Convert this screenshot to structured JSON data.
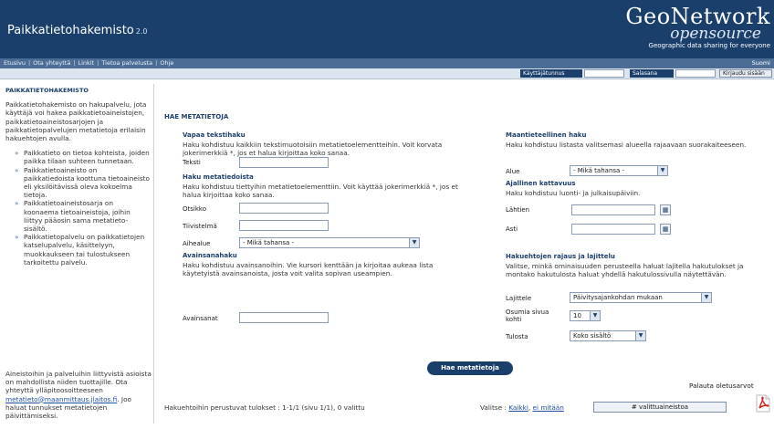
{
  "header": {
    "title": "Paikkatietohakemisto",
    "version": "2.0",
    "logo_main": "GeoNetwork",
    "logo_sub": "opensource",
    "logo_tagline": "Geographic data sharing for everyone"
  },
  "topnav": {
    "links": [
      "Etusivu",
      "Ota yhteyttä",
      "Linkit",
      "Tietoa palvelusta",
      "Ohje"
    ],
    "right": "Suomi"
  },
  "loginbar": {
    "user_label": "Käyttäjätunnus",
    "password_label": "Salasana",
    "login_button": "Kirjaudu sisään"
  },
  "sidebar": {
    "title": "PAIKKATIETOHAKEMISTO",
    "intro": "Paikkatietohakemisto on hakupalvelu, jota käyttäjä voi hakea paikkatietoaineistojen, paikkatietoaineistosarjojen ja paikkatietopalvelujen metatietoja erilaisin hakuehtojen avulla.",
    "items": [
      "Paikkatieto on tietoa kohteista, joiden paikka tilaan suhteen tunnetaan.",
      "Paikkatietoaineisto on paikkatiedoista koottuna tietoaineisto eli yksilöitävissä oleva kokoelma tietoja.",
      "Paikkatietoaineistosarja on koonaema tietoaineistoja, joihin liittyy pääosin sama metatieto-sisältö.",
      "Paikkatietopalvelu on paikkatietojen katselupalvelu, käsittelyyn, muokkaukseen tai tulostukseen tarkoitettu palvelu."
    ],
    "footer_text": "Aineistoihin ja palveluihin liittyvistä asioista on mahdollista niiden tuottajille. Ota yhteyttä ylläpitoosoitteeseen",
    "footer_email": "metatieto@maanmittaus.jlaitos.fi",
    "footer_text2": ". Joo haluat tunnukset metatietojen päivittämiseksi."
  },
  "main": {
    "heading": "HAE METATIETOJA",
    "free_text": {
      "title": "Vapaa tekstihaku",
      "desc": "Haku kohdistuu kaikkiin tekstimuotoisiin metatietoelementteihin. Voit korvata jokerimerkkiä *, jos et halua kirjoittaa koko sanaa.",
      "field_label": "Teksti"
    },
    "elements": {
      "title": "Haku metatiedoista",
      "desc": "Haku kohdistuu tiettyihin metatietoelementtiin. Voit käyttää jokerimerkkiä *, jos et halua kirjoittaa koko sanaa.",
      "title_label": "Otsikko",
      "abstract_label": "Tiivistelmä",
      "category_label": "Aihealue",
      "category_value": "- Mikä tahansa -"
    },
    "keyword": {
      "title": "Avainsanahaku",
      "desc": "Haku kohdistuu avainsanoihin. Vie kursori kenttään ja kirjoitaa aukeaa lista käytetyistä avainsanoista, josta voit valita sopivan useampien.",
      "field_label": "Avainsanat"
    },
    "spatial": {
      "title": "Maantieteellinen haku",
      "desc": "Haku kohdistuu listasta valitsemasi alueella rajaavaan suorakaiteeseen.",
      "area_label": "Alue",
      "area_value": "- Mikä tahansa -"
    },
    "temporal": {
      "title": "Ajallinen kattavuus",
      "desc": "Haku kohdistuu luonti- ja julkaisupäiviin.",
      "from_label": "Lähtien",
      "to_label": "Asti"
    },
    "options": {
      "title": "Hakuehtojen rajaus ja lajittelu",
      "desc": "Valitse, minkä ominaisuuden perusteella haluat lajitella hakutulokset ja montako hakutulosta haluat yhdellä hakutulossivulla näytettävän.",
      "sort_label": "Lajittele",
      "sort_value": "Päivitysajankohdan mukaan",
      "hits_label": "Osumia sivua kohti",
      "hits_value": "10",
      "output_label": "Tulosta",
      "output_value": "Koko sisältö"
    },
    "search_button": "Hae metatietoja",
    "reset_link": "Palauta oletusarvot",
    "results_text": "Hakuehtoihin perustuvat tulokset :  1-1/1  (sivu 1/1),  0 valittu",
    "choose_label": "Valitse :",
    "choose_all": "Kaikki",
    "choose_none": "ei mitään",
    "selected_button": "# valittuaineistoa"
  }
}
